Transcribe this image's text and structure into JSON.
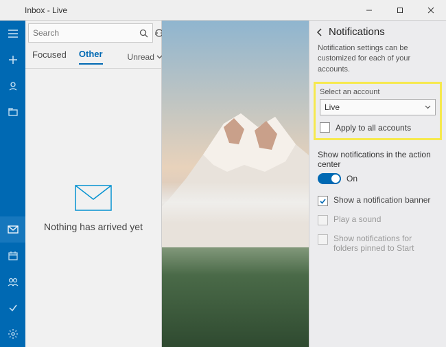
{
  "titlebar": {
    "title": "Inbox - Live"
  },
  "rail": {
    "items": [
      "menu-icon",
      "new-icon",
      "account-icon",
      "folders-icon"
    ],
    "bottom": [
      "mail-icon",
      "calendar-icon",
      "people-icon",
      "todo-icon",
      "settings-icon"
    ]
  },
  "search": {
    "placeholder": "Search"
  },
  "tabs": {
    "focused": "Focused",
    "other": "Other",
    "unread": "Unread"
  },
  "empty": {
    "message": "Nothing has arrived yet"
  },
  "panel": {
    "title": "Notifications",
    "subtitle": "Notification settings can be customized for each of your accounts.",
    "select_label": "Select an account",
    "select_value": "Live",
    "apply_all": "Apply to all accounts",
    "action_center_label": "Show notifications in the action center",
    "toggle_state": "On",
    "opt_banner": "Show a notification banner",
    "opt_sound": "Play a sound",
    "opt_pinned": "Show notifications for folders pinned to Start"
  }
}
